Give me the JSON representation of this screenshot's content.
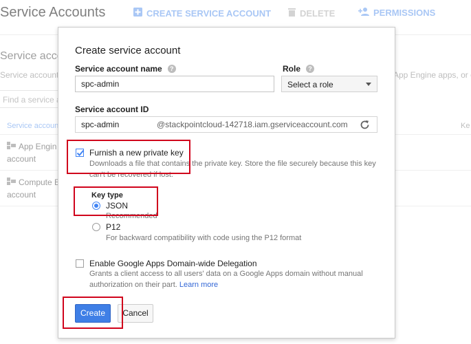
{
  "background": {
    "page_title": "Service Accounts",
    "actions": [
      {
        "label": "CREATE SERVICE ACCOUNT",
        "icon": "add-box-icon"
      },
      {
        "label": "DELETE",
        "icon": "trash-icon"
      },
      {
        "label": "PERMISSIONS",
        "icon": "person-add-icon"
      }
    ],
    "section_title": "Service accoun",
    "description_left": "Service account r",
    "description_right": "App Engine apps, or o",
    "search_placeholder": "Find a service a",
    "column_header": "Service accoun",
    "column_key": "Ke",
    "rows": [
      {
        "line1": "App Engin",
        "line2": "account",
        "icon": "key-icon"
      },
      {
        "line1": "Compute E",
        "line2": "account",
        "icon": "key-icon"
      }
    ]
  },
  "dialog": {
    "title": "Create service account",
    "name_field": {
      "label": "Service account name",
      "value": "spc-admin"
    },
    "role_field": {
      "label": "Role",
      "value": "Select a role"
    },
    "id_field": {
      "label": "Service account ID",
      "value": "spc-admin",
      "suffix": "@stackpointcloud-142718.iam.gserviceaccount.com"
    },
    "private_key": {
      "label": "Furnish a new private key",
      "checked": true,
      "hint": "Downloads a file that contains the private key. Store the file securely because this key can't be recovered if lost."
    },
    "key_type": {
      "label": "Key type",
      "options": [
        {
          "label": "JSON",
          "hint": "Recommended",
          "selected": true
        },
        {
          "label": "P12",
          "hint": "For backward compatibility with code using the P12 format",
          "selected": false
        }
      ]
    },
    "delegation": {
      "label": "Enable Google Apps Domain-wide Delegation",
      "checked": false,
      "hint": "Grants a client access to all users' data on a Google Apps domain without manual authorization on their part.",
      "link": "Learn more"
    },
    "create_label": "Create",
    "cancel_label": "Cancel"
  },
  "colors": {
    "accent": "#4285f4",
    "primary_button": "#3f7fe6",
    "annotation": "#d0021b",
    "link": "#3367d6"
  }
}
